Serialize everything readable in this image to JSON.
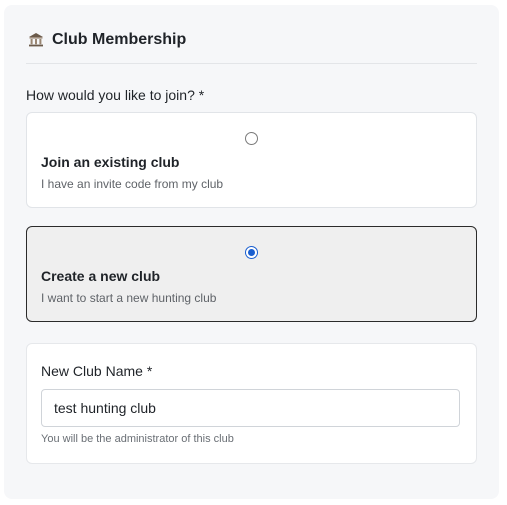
{
  "header": {
    "icon": "bank-building-icon",
    "title": "Club Membership"
  },
  "question": "How would you like to join? *",
  "options": [
    {
      "title": "Join an existing club",
      "subtitle": "I have an invite code from my club",
      "selected": false
    },
    {
      "title": "Create a new club",
      "subtitle": "I want to start a new hunting club",
      "selected": true
    }
  ],
  "club_name": {
    "label": "New Club Name *",
    "value": "test hunting club",
    "help": "You will be the administrator of this club"
  },
  "colors": {
    "accent": "#1a5fd0",
    "selected_border": "#2b2b2b",
    "panel_bg": "#f6f7f9"
  }
}
